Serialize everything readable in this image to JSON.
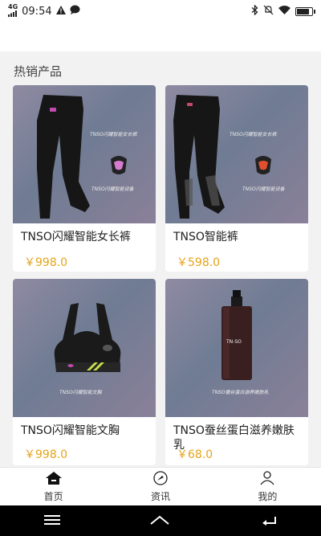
{
  "status": {
    "network": "4G",
    "time": "09:54"
  },
  "section_title": "热销产品",
  "products": [
    {
      "name": "TNSO闪耀智能女长裤",
      "price": "￥998.0",
      "tag1": "TNSO闪耀智能女长裤",
      "tag2": "TNSO闪耀智能设备"
    },
    {
      "name": "TNSO智能裤",
      "price": "￥598.0",
      "tag1": "TNSO闪耀智能女长裤",
      "tag2": "TNSO闪耀智能设备"
    },
    {
      "name": "TNSO闪耀智能文胸",
      "price": "￥998.0",
      "tag1": "TNSO闪耀智能文胸"
    },
    {
      "name": "TNSO蚕丝蛋白滋养嫩肤乳",
      "price": "￥68.0",
      "tag1": "TNSO蚕丝蛋白滋养嫩肤乳",
      "bottle_label": "TN-SO"
    }
  ],
  "tabs": [
    {
      "label": "首页",
      "icon": "home-icon"
    },
    {
      "label": "资讯",
      "icon": "news-icon"
    },
    {
      "label": "我的",
      "icon": "profile-icon"
    }
  ],
  "colors": {
    "price": "#e6a317",
    "navbar": "#000000"
  },
  "battery_level": 0.9
}
